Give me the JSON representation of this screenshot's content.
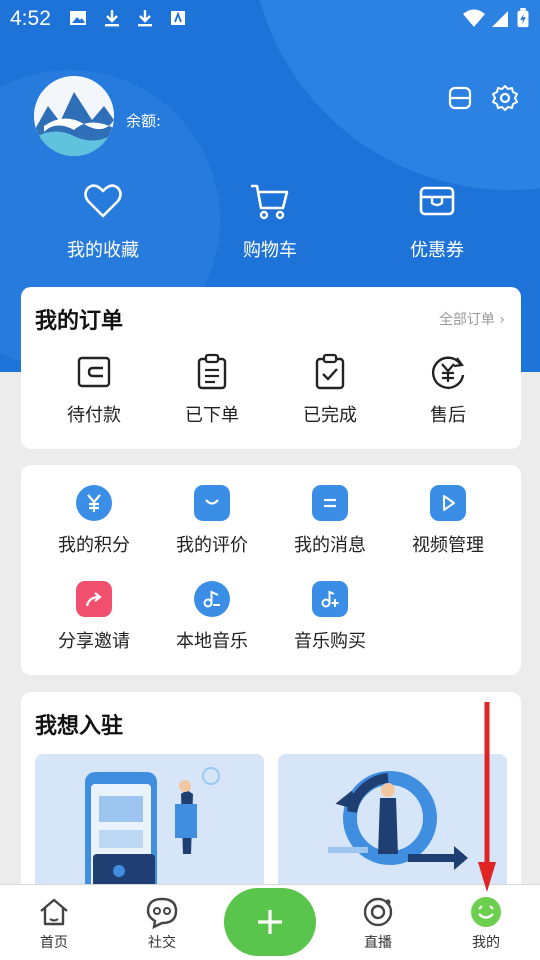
{
  "status_bar": {
    "time": "4:52"
  },
  "profile": {
    "balance_label": "余额:"
  },
  "quick_actions": [
    {
      "label": "我的收藏",
      "icon": "heart-icon"
    },
    {
      "label": "购物车",
      "icon": "cart-icon"
    },
    {
      "label": "优惠券",
      "icon": "coupon-icon"
    }
  ],
  "orders": {
    "title": "我的订单",
    "all_orders_label": "全部订单",
    "items": [
      {
        "label": "待付款",
        "icon": "wallet-icon"
      },
      {
        "label": "已下单",
        "icon": "clipboard-icon"
      },
      {
        "label": "已完成",
        "icon": "clipboard-check-icon"
      },
      {
        "label": "售后",
        "icon": "yuan-refresh-icon"
      }
    ]
  },
  "services": [
    {
      "label": "我的积分",
      "icon": "points-icon",
      "color": "#3a8ee6"
    },
    {
      "label": "我的评价",
      "icon": "review-icon",
      "color": "#3a8ee6"
    },
    {
      "label": "我的消息",
      "icon": "message-icon",
      "color": "#3a8ee6"
    },
    {
      "label": "视频管理",
      "icon": "video-icon",
      "color": "#3a8ee6"
    },
    {
      "label": "分享邀请",
      "icon": "share-icon",
      "color": "#f0506e"
    },
    {
      "label": "本地音乐",
      "icon": "music-icon",
      "color": "#3a8ee6"
    },
    {
      "label": "音乐购买",
      "icon": "music-buy-icon",
      "color": "#3a8ee6"
    }
  ],
  "join": {
    "title": "我想入驻"
  },
  "tabbar": {
    "items": [
      {
        "label": "首页",
        "icon": "home-icon"
      },
      {
        "label": "社交",
        "icon": "chat-icon"
      },
      {
        "label": "",
        "icon": "plus-icon"
      },
      {
        "label": "直播",
        "icon": "live-icon"
      },
      {
        "label": "我的",
        "icon": "smile-icon"
      }
    ]
  },
  "colors": {
    "primary": "#1e73d8",
    "accent_green": "#59c54c",
    "annotation_red": "#e02424"
  }
}
